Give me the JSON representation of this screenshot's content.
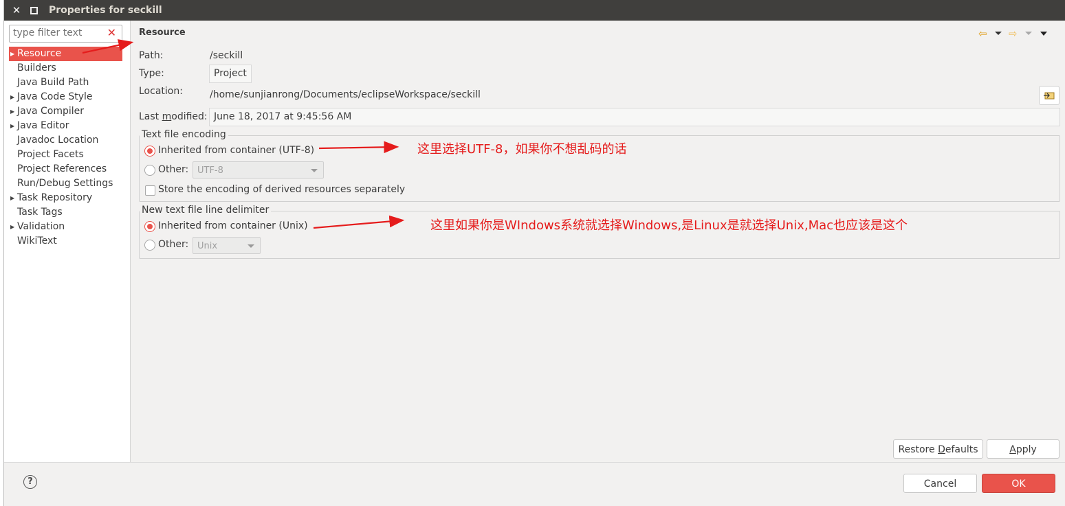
{
  "window": {
    "title": "Properties for seckill"
  },
  "filter": {
    "placeholder": "type filter text"
  },
  "sidebar": {
    "items": [
      {
        "label": "Resource",
        "expandable": true,
        "selected": true
      },
      {
        "label": "Builders",
        "expandable": false
      },
      {
        "label": "Java Build Path",
        "expandable": false
      },
      {
        "label": "Java Code Style",
        "expandable": true
      },
      {
        "label": "Java Compiler",
        "expandable": true
      },
      {
        "label": "Java Editor",
        "expandable": true
      },
      {
        "label": "Javadoc Location",
        "expandable": false
      },
      {
        "label": "Project Facets",
        "expandable": false
      },
      {
        "label": "Project References",
        "expandable": false
      },
      {
        "label": "Run/Debug Settings",
        "expandable": false
      },
      {
        "label": "Task Repository",
        "expandable": true
      },
      {
        "label": "Task Tags",
        "expandable": false
      },
      {
        "label": "Validation",
        "expandable": true
      },
      {
        "label": "WikiText",
        "expandable": false
      }
    ]
  },
  "page": {
    "title": "Resource",
    "path_label": "Path:",
    "path_value": "/seckill",
    "type_label": "Type:",
    "type_value": "Project",
    "location_label": "Location:",
    "location_value": "/home/sunjianrong/Documents/eclipseWorkspace/seckill",
    "modified_label": "Last modified:",
    "modified_value": "June 18, 2017 at 9:45:56 AM"
  },
  "encoding": {
    "group_title": "Text file encoding",
    "inherited_label": "Inherited from container (UTF-8)",
    "other_label": "Other:",
    "other_value": "UTF-8",
    "store_label": "Store the encoding of derived resources separately",
    "selected": "inherited"
  },
  "delimiter": {
    "group_title": "New text file line delimiter",
    "inherited_label": "Inherited from container (Unix)",
    "other_label": "Other:",
    "other_value": "Unix",
    "selected": "inherited"
  },
  "buttons": {
    "restore": "Restore Defaults",
    "apply": "Apply",
    "cancel": "Cancel",
    "ok": "OK",
    "help": "?"
  },
  "annotations": {
    "encoding_note": "这里选择UTF-8，如果你不想乱码的话",
    "delimiter_note": "这里如果你是WIndows系统就选择Windows,是Linux是就选择Unix,Mac也应该是这个"
  },
  "colors": {
    "accent": "#e9534b",
    "titlebar": "#403f3d",
    "annotation": "#e51c1c"
  },
  "icons": [
    "close-icon",
    "maximize-icon",
    "clear-filter-icon",
    "back-icon",
    "forward-icon",
    "menu-icon",
    "show-in-system-explorer-icon",
    "help-icon"
  ]
}
